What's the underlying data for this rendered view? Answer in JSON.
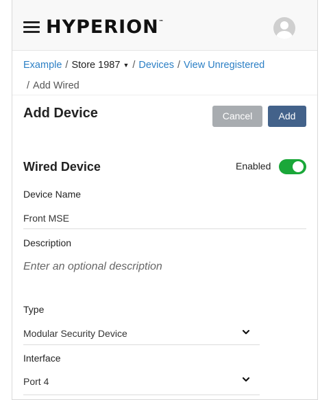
{
  "header": {
    "brand": "HYPERION",
    "trademark": "™"
  },
  "breadcrumb": {
    "items": [
      "Example",
      "Store 1987",
      "Devices",
      "View Unregistered",
      "Add Wired"
    ],
    "separator": "/"
  },
  "page": {
    "title": "Add Device",
    "cancel_label": "Cancel",
    "add_label": "Add"
  },
  "section": {
    "title": "Wired Device",
    "enabled_label": "Enabled",
    "enabled": true
  },
  "form": {
    "device_name": {
      "label": "Device Name",
      "value": "Front MSE"
    },
    "description": {
      "label": "Description",
      "placeholder": "Enter an optional description"
    },
    "type": {
      "label": "Type",
      "value": "Modular Security Device"
    },
    "interface": {
      "label": "Interface",
      "value": "Port 4"
    }
  },
  "colors": {
    "link": "#2b7fc5",
    "cancel_button": "#a8acb0",
    "add_button": "#43628a",
    "toggle_on": "#1aa739"
  },
  "icons": [
    "menu-icon",
    "user-avatar-icon",
    "caret-down-icon",
    "chevron-down-icon"
  ]
}
